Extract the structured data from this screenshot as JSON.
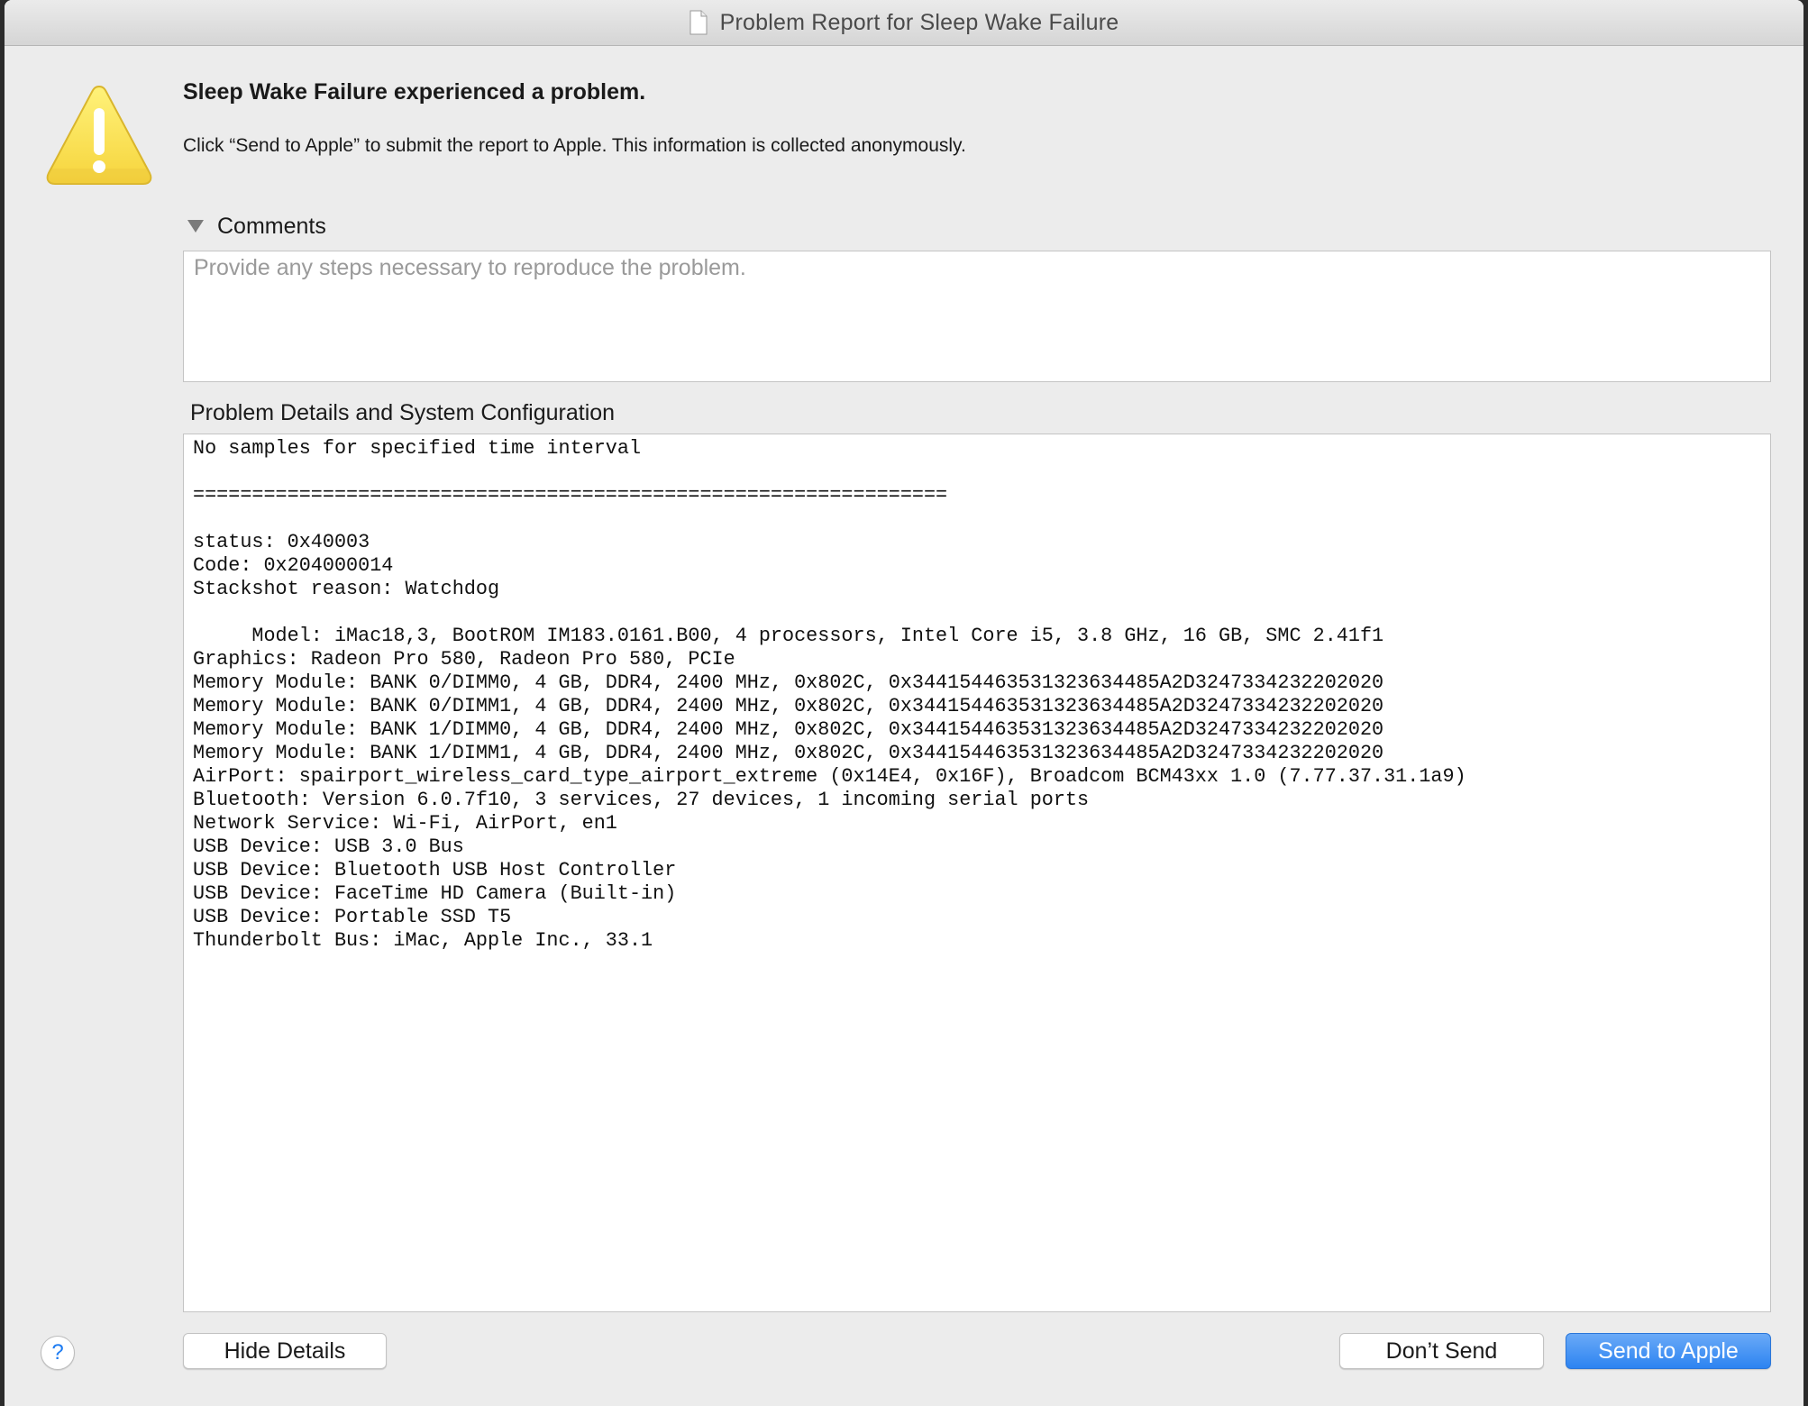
{
  "window": {
    "title": "Problem Report for Sleep Wake Failure",
    "title_icon": "document-icon"
  },
  "alert": {
    "icon": "warning-icon",
    "heading": "Sleep Wake Failure experienced a problem.",
    "message": "Click “Send to Apple” to submit the report to Apple. This information is collected anonymously."
  },
  "comments": {
    "label": "Comments",
    "expanded": true,
    "value": "",
    "placeholder": "Provide any steps necessary to reproduce the problem."
  },
  "details": {
    "label": "Problem Details and System Configuration",
    "lines": [
      "No samples for specified time interval",
      "",
      "================================================================",
      "",
      "status: 0x40003",
      "Code: 0x204000014",
      "Stackshot reason: Watchdog",
      "",
      "     Model: iMac18,3, BootROM IM183.0161.B00, 4 processors, Intel Core i5, 3.8 GHz, 16 GB, SMC 2.41f1",
      "Graphics: Radeon Pro 580, Radeon Pro 580, PCIe",
      "Memory Module: BANK 0/DIMM0, 4 GB, DDR4, 2400 MHz, 0x802C, 0x3441544635313236344​85A2D3247334232202020",
      "Memory Module: BANK 0/DIMM1, 4 GB, DDR4, 2400 MHz, 0x802C, 0x34415446353132363448​5A2D3247334232202020",
      "Memory Module: BANK 1/DIMM0, 4 GB, DDR4, 2400 MHz, 0x802C, 0x34415446353132363448​5A2D3247334232202020",
      "Memory Module: BANK 1/DIMM1, 4 GB, DDR4, 2400 MHz, 0x802C, 0x34415446353132363448​5A2D3247334232202020",
      "AirPort: spairport_wireless_card_type_airport_extreme (0x14E4, 0x16F), Broadcom BCM43xx 1.0 (7.77.37.31.1a9)",
      "Bluetooth: Version 6.0.7f10, 3 services, 27 devices, 1 incoming serial ports",
      "Network Service: Wi-Fi, AirPort, en1",
      "USB Device: USB 3.0 Bus",
      "USB Device: Bluetooth USB Host Controller",
      "USB Device: FaceTime HD Camera (Built-in)",
      "USB Device: Portable SSD T5",
      "Thunderbolt Bus: iMac, Apple Inc., 33.1"
    ]
  },
  "buttons": {
    "help": "?",
    "hide_details": "Hide Details",
    "dont_send": "Don’t Send",
    "send_to_apple": "Send to Apple"
  },
  "colors": {
    "window_bg": "#ececec",
    "warning_yellow": "#ffe05a",
    "accent_blue": "#2d84f1"
  }
}
